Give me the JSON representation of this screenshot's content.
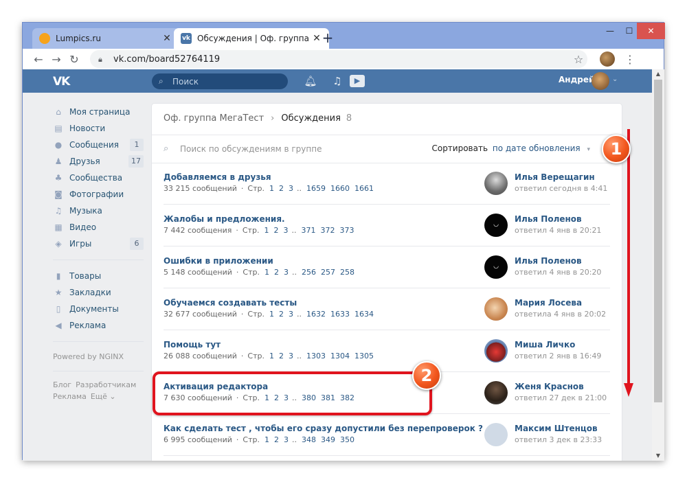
{
  "browser": {
    "tabs": [
      {
        "title": "Lumpics.ru",
        "active": false
      },
      {
        "title": "Обсуждения | Оф. группа МегаТ",
        "active": true
      }
    ],
    "close_glyph": "✕",
    "newtab_glyph": "+",
    "win_controls": {
      "minimize": "—",
      "maximize": "☐",
      "close": "✕"
    },
    "url": "vk.com/board52764119",
    "nav": {
      "back": "←",
      "forward": "→",
      "reload": "↻"
    },
    "star": "☆",
    "menu": "⋮"
  },
  "vk": {
    "logo": "VK",
    "search_placeholder": "Поиск",
    "header_icons": [
      "bell-icon",
      "music-icon",
      "video-icon"
    ],
    "user_name": "Андрей",
    "user_caret": "⌄"
  },
  "menu": {
    "items": [
      {
        "label": "Моя страница",
        "icon": "home-icon",
        "glyph": "⌂",
        "count": null
      },
      {
        "label": "Новости",
        "icon": "news-icon",
        "glyph": "▤",
        "count": null
      },
      {
        "label": "Сообщения",
        "icon": "messages-icon",
        "glyph": "●",
        "count": "1"
      },
      {
        "label": "Друзья",
        "icon": "friends-icon",
        "glyph": "♟",
        "count": "17"
      },
      {
        "label": "Сообщества",
        "icon": "communities-icon",
        "glyph": "♣",
        "count": null
      },
      {
        "label": "Фотографии",
        "icon": "photo-icon",
        "glyph": "◙",
        "count": null
      },
      {
        "label": "Музыка",
        "icon": "music-icon",
        "glyph": "♫",
        "count": null
      },
      {
        "label": "Видео",
        "icon": "video-icon",
        "glyph": "▦",
        "count": null
      },
      {
        "label": "Игры",
        "icon": "games-icon",
        "glyph": "◈",
        "count": "6"
      }
    ],
    "items2": [
      {
        "label": "Товары",
        "icon": "goods-icon",
        "glyph": "▮"
      },
      {
        "label": "Закладки",
        "icon": "bookmarks-icon",
        "glyph": "★"
      },
      {
        "label": "Документы",
        "icon": "documents-icon",
        "glyph": "▯"
      },
      {
        "label": "Реклама",
        "icon": "ads-icon",
        "glyph": "◀"
      }
    ],
    "powered": "Powered by NGINX",
    "footer_links": [
      "Блог",
      "Разработчикам",
      "Реклама",
      "Ещё ⌄"
    ]
  },
  "board": {
    "breadcrumb_group": "Оф. группа МегаТест",
    "breadcrumb_sep": "›",
    "breadcrumb_current": "Обсуждения",
    "breadcrumb_count": "8",
    "search_placeholder": "Поиск по обсуждениям в группе",
    "sort_label": "Сортировать",
    "sort_value": "по дате обновления",
    "sort_caret": "▾",
    "topics": [
      {
        "title": "Добавляемся в друзья",
        "messages": "33 215 сообщений",
        "pages_label": "Стр.",
        "pages_first": [
          "1",
          "2",
          "3"
        ],
        "pages_last": [
          "1659",
          "1660",
          "1661"
        ],
        "author": "Илья Верещагин",
        "date": "ответил сегодня в 4:41",
        "avatar": "av1"
      },
      {
        "title": "Жалобы и предложения.",
        "messages": "7 442 сообщения",
        "pages_label": "Стр.",
        "pages_first": [
          "1",
          "2",
          "3"
        ],
        "pages_last": [
          "371",
          "372",
          "373"
        ],
        "author": "Илья Поленов",
        "date": "ответил 4 янв в 20:21",
        "avatar": "av2"
      },
      {
        "title": "Ошибки в приложении",
        "messages": "5 148 сообщений",
        "pages_label": "Стр.",
        "pages_first": [
          "1",
          "2",
          "3"
        ],
        "pages_last": [
          "256",
          "257",
          "258"
        ],
        "author": "Илья Поленов",
        "date": "ответил 4 янв в 20:20",
        "avatar": "av2"
      },
      {
        "title": "Обучаемся создавать тесты",
        "messages": "32 677 сообщений",
        "pages_label": "Стр.",
        "pages_first": [
          "1",
          "2",
          "3"
        ],
        "pages_last": [
          "1632",
          "1633",
          "1634"
        ],
        "author": "Мария Лосева",
        "date": "ответила 4 янв в 20:02",
        "avatar": "av3"
      },
      {
        "title": "Помощь тут",
        "messages": "26 088 сообщений",
        "pages_label": "Стр.",
        "pages_first": [
          "1",
          "2",
          "3"
        ],
        "pages_last": [
          "1303",
          "1304",
          "1305"
        ],
        "author": "Миша Личко",
        "date": "ответил 2 янв в 16:49",
        "avatar": "av4"
      },
      {
        "title": "Активация редактора",
        "messages": "7 630 сообщений",
        "pages_label": "Стр.",
        "pages_first": [
          "1",
          "2",
          "3"
        ],
        "pages_last": [
          "380",
          "381",
          "382"
        ],
        "author": "Женя Краснов",
        "date": "ответил 27 дек в 21:00",
        "avatar": "av5"
      },
      {
        "title": "Как сделать тест , чтобы его сразу допустили без перепроверок ?",
        "messages": "6 995 сообщений",
        "pages_label": "Стр.",
        "pages_first": [
          "1",
          "2",
          "3"
        ],
        "pages_last": [
          "348",
          "349",
          "350"
        ],
        "author": "Максим Штенцов",
        "date": "ответил 3 дек в 23:33",
        "avatar": "av6"
      }
    ]
  },
  "annotations": {
    "badge1": "1",
    "badge2": "2",
    "color": "#e0141e"
  },
  "colors": {
    "vk_blue": "#4a76a8",
    "link": "#2a5885",
    "window_frame": "#8ba7df"
  }
}
